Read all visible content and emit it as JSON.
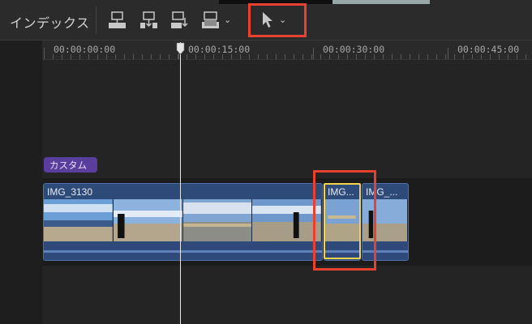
{
  "toolbar": {
    "index_label": "インデックス",
    "buttons": [
      "connect-clip-icon",
      "insert-clip-icon",
      "append-clip-icon",
      "overwrite-clip-icon",
      "select-tool-icon"
    ]
  },
  "ruler": {
    "timecodes": [
      "00:00:00:00",
      "00:00:15:00",
      "00:00:30:00",
      "00:00:45:00"
    ]
  },
  "timeline": {
    "role_tag": "カスタム",
    "clips": [
      {
        "name": "IMG_3130"
      },
      {
        "name": "IMG..."
      },
      {
        "name": "IMG_..."
      }
    ],
    "playhead_timecode": "00:00:15:00"
  },
  "colors": {
    "highlight": "#e8412f",
    "selection": "#f2d44a",
    "clip_blue": "#2d4a78",
    "role_purple": "#5a3e9e"
  }
}
